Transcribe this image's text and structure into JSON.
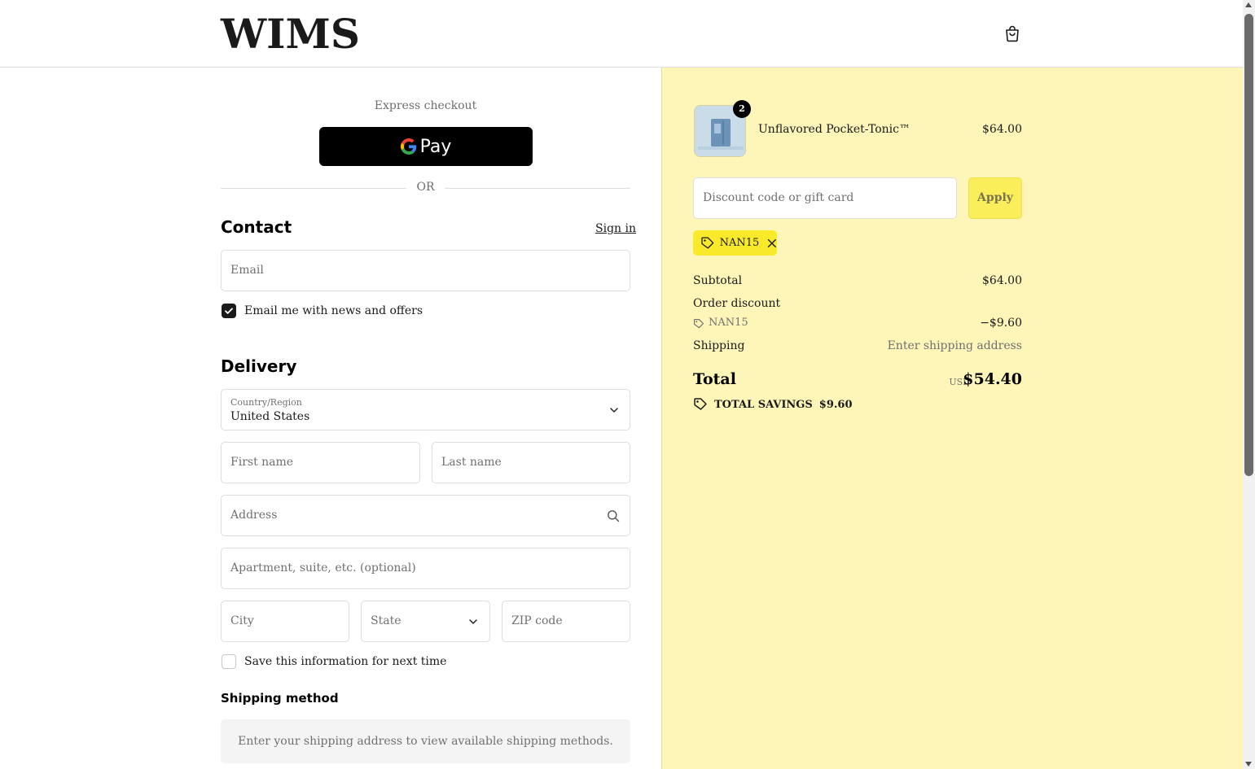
{
  "header": {
    "logo": "WIMS",
    "cart_icon": "shopping-bag-icon"
  },
  "express": {
    "label": "Express checkout",
    "gpay_label": "Pay"
  },
  "divider": {
    "or": "OR"
  },
  "contact": {
    "title": "Contact",
    "sign_in": "Sign in",
    "email_placeholder": "Email",
    "newsletter_label": "Email me with news and offers",
    "newsletter_checked": true
  },
  "delivery": {
    "title": "Delivery",
    "country_label": "Country/Region",
    "country_value": "United States",
    "first_name_placeholder": "First name",
    "last_name_placeholder": "Last name",
    "address_placeholder": "Address",
    "apartment_placeholder": "Apartment, suite, etc. (optional)",
    "city_placeholder": "City",
    "state_placeholder": "State",
    "zip_placeholder": "ZIP code",
    "save_info_label": "Save this information for next time",
    "save_info_checked": false
  },
  "shipping_method": {
    "title": "Shipping method",
    "message": "Enter your shipping address to view available shipping methods."
  },
  "summary": {
    "item": {
      "name": "Unflavored Pocket-Tonic™",
      "price": "$64.00",
      "quantity": "2"
    },
    "discount_placeholder": "Discount code or gift card",
    "apply_label": "Apply",
    "applied_code": "NAN15",
    "subtotal_label": "Subtotal",
    "subtotal_value": "$64.00",
    "order_discount_label": "Order discount",
    "discount_code": "NAN15",
    "discount_value": "−$9.60",
    "shipping_label": "Shipping",
    "shipping_value": "Enter shipping address",
    "total_label": "Total",
    "total_currency": "USD",
    "total_value": "$54.40",
    "savings_label": "TOTAL SAVINGS",
    "savings_value": "$9.60"
  },
  "colors": {
    "summary_bg": "#fef5b8",
    "apply_bg": "#faee5a",
    "chip_bg": "#f8ea2a",
    "primary": "#1a1a1a"
  }
}
